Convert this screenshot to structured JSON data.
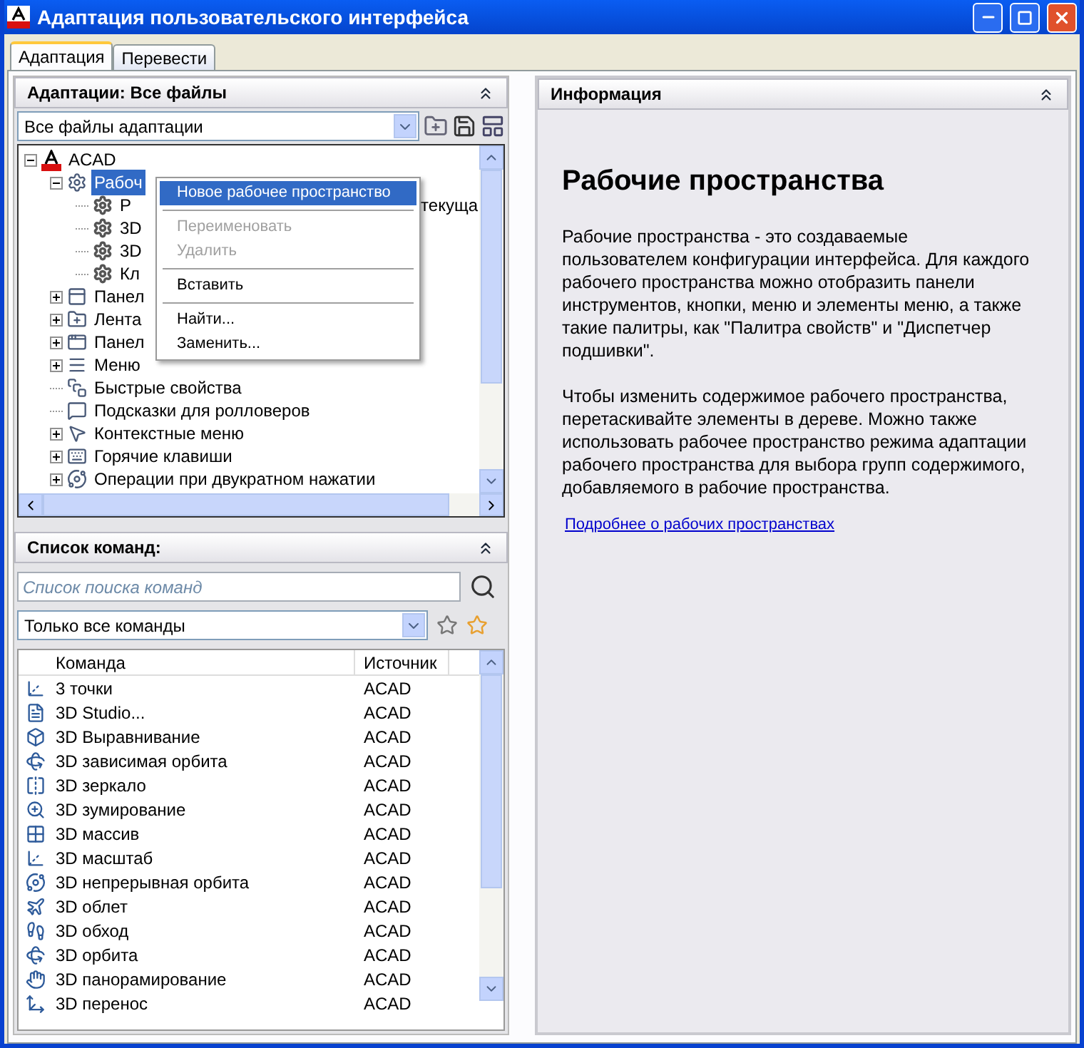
{
  "window": {
    "title": "Адаптация пользовательского интерфейса"
  },
  "tabs": [
    {
      "label": "Адаптация",
      "selected": true
    },
    {
      "label": "Перевести",
      "selected": false
    }
  ],
  "customizations_panel": {
    "title": "Адаптации: Все файлы",
    "file_select": {
      "value": "Все файлы адаптации"
    },
    "tree": [
      {
        "label": "ACAD",
        "selected": false,
        "expanded": true,
        "children": [
          {
            "label": "Рабоч",
            "selected": true,
            "expanded": true,
            "children": [
              {
                "label": "Р",
                "note": "текуща",
                "selected": false
              },
              {
                "label": "3D",
                "selected": false
              },
              {
                "label": "3D",
                "selected": false
              },
              {
                "label": "Кл",
                "selected": false
              }
            ]
          },
          {
            "label": "Панел",
            "selected": false,
            "expanded": false
          },
          {
            "label": "Лента",
            "selected": false,
            "expanded": false
          },
          {
            "label": "Панел",
            "selected": false,
            "expanded": false
          },
          {
            "label": "Меню",
            "selected": false,
            "expanded": false
          },
          {
            "label": "Быстрые свойства",
            "selected": false
          },
          {
            "label": "Подсказки для ролловеров",
            "selected": false
          },
          {
            "label": "Контекстные меню",
            "selected": false,
            "expanded": false
          },
          {
            "label": "Горячие клавиши",
            "selected": false,
            "expanded": false
          },
          {
            "label": "Операции при двукратном нажатии",
            "selected": false,
            "expanded": false
          }
        ]
      }
    ],
    "context_menu": [
      {
        "kind": "item",
        "label": "Новое рабочее пространство",
        "selected": true,
        "disabled": false
      },
      {
        "kind": "separator"
      },
      {
        "kind": "item",
        "label": "Переименовать",
        "selected": false,
        "disabled": true
      },
      {
        "kind": "item",
        "label": "Удалить",
        "selected": false,
        "disabled": true
      },
      {
        "kind": "separator"
      },
      {
        "kind": "item",
        "label": "Вставить",
        "selected": false,
        "disabled": false
      },
      {
        "kind": "separator"
      },
      {
        "kind": "item",
        "label": "Найти...",
        "selected": false,
        "disabled": false
      },
      {
        "kind": "item",
        "label": "Заменить...",
        "selected": false,
        "disabled": false
      }
    ]
  },
  "commands_panel": {
    "title": "Список команд:",
    "search": {
      "placeholder": "Список поиска команд"
    },
    "filter_select": {
      "value": "Только все команды"
    },
    "columns": [
      "Команда",
      "Источник"
    ],
    "rows": [
      [
        "3 точки",
        "ACAD"
      ],
      [
        "3D Studio...",
        "ACAD"
      ],
      [
        "3D Выравнивание",
        "ACAD"
      ],
      [
        "3D зависимая орбита",
        "ACAD"
      ],
      [
        "3D зеркало",
        "ACAD"
      ],
      [
        "3D зумирование",
        "ACAD"
      ],
      [
        "3D массив",
        "ACAD"
      ],
      [
        "3D масштаб",
        "ACAD"
      ],
      [
        "3D непрерывная орбита",
        "ACAD"
      ],
      [
        "3D облет",
        "ACAD"
      ],
      [
        "3D обход",
        "ACAD"
      ],
      [
        "3D орбита",
        "ACAD"
      ],
      [
        "3D панорамирование",
        "ACAD"
      ],
      [
        "3D перенос",
        "ACAD"
      ]
    ]
  },
  "info_panel": {
    "title": "Информация",
    "heading": "Рабочие пространства",
    "paragraphs": [
      "Рабочие пространства - это создаваемые пользователем конфигурации интерфейса. Для каждого рабочего пространства можно отобразить панели инструментов, кнопки, меню и элементы меню, а также такие палитры, как \"Палитра свойств\" и \"Диспетчер подшивки\".",
      "Чтобы изменить содержимое рабочего пространства, перетаскивайте элементы в дереве. Можно также использовать рабочее пространство режима адаптации рабочего пространства для выбора групп содержимого, добавляемого в рабочие пространства."
    ],
    "link": "Подробнее о рабочих пространствах"
  }
}
